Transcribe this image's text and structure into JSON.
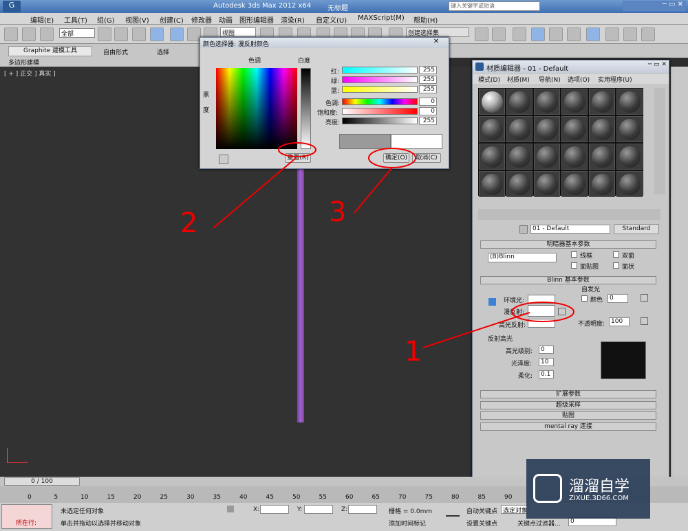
{
  "app": {
    "title": "Autodesk 3ds Max  2012 x64",
    "doc": "无标题",
    "search_placeholder": "键入关键字或短语"
  },
  "menu": [
    "编辑(E)",
    "工具(T)",
    "组(G)",
    "视图(V)",
    "创建(C)",
    "修改器",
    "动画",
    "图形编辑器",
    "渲染(R)",
    "自定义(U)",
    "MAXScript(M)",
    "帮助(H)"
  ],
  "toolbar": {
    "selection_filter": "全部",
    "ref_coord": "视图",
    "named_sel": "创建选择集"
  },
  "ribbon": {
    "tab1": "Graphite 建模工具",
    "tab2": "自由形式",
    "tab3": "选择",
    "panel": "多边形建模"
  },
  "viewport": {
    "label": "[ + ] 正交 ] 真实 ]"
  },
  "color_dialog": {
    "title": "颜色选择器: 漫反射颜色",
    "hue_label": "色调",
    "white_label": "白度",
    "black_label": "黑",
    "degree_label": "度",
    "red": "红:",
    "green": "绿:",
    "blue": "蓝:",
    "hue": "色调:",
    "sat": "饱和度:",
    "val": "亮度:",
    "red_val": "255",
    "green_val": "255",
    "blue_val": "255",
    "hue_val": "0",
    "sat_val": "0",
    "val_val": "255",
    "reset": "重置(R)",
    "ok": "确定(O)",
    "cancel": "取消(C)"
  },
  "mat_editor": {
    "title": "材质编辑器 - 01 - Default",
    "menu": [
      "模式(D)",
      "材质(M)",
      "导航(N)",
      "选项(O)",
      "实用程序(U)"
    ],
    "mat_name": "01 - Default",
    "mat_type": "Standard",
    "shader_rollout": "明暗器基本参数",
    "shader": "(B)Blinn",
    "wire": "线框",
    "two_sided": "双面",
    "face_map": "面贴图",
    "faceted": "面状",
    "blinn_rollout": "Blinn 基本参数",
    "self_illum": "自发光",
    "color": "颜色",
    "self_val": "0",
    "ambient": "环境光:",
    "diffuse": "漫反射:",
    "specular": "高光反射:",
    "opacity": "不透明度:",
    "opacity_val": "100",
    "spec_hl": "反射高光",
    "spec_level": "高光级别:",
    "spec_level_val": "0",
    "gloss": "光泽度:",
    "gloss_val": "10",
    "soften": "柔化:",
    "soften_val": "0.1",
    "extended": "扩展参数",
    "supersample": "超级采样",
    "maps": "贴图",
    "mental_ray": "mental ray 连接"
  },
  "timeline": {
    "frame": "0 / 100",
    "ticks": [
      "0",
      "5",
      "10",
      "15",
      "20",
      "25",
      "30",
      "35",
      "40",
      "45",
      "50",
      "55",
      "60",
      "65",
      "70",
      "75",
      "80",
      "85",
      "90"
    ]
  },
  "status": {
    "loc": "所在行:",
    "msg1": "未选定任何对象",
    "msg2": "单击并拖动以选择并移动对象",
    "x": "X:",
    "y": "Y:",
    "z": "Z:",
    "grid": "栅格 = 0.0mm",
    "addkey": "添加时间标记",
    "autokey": "自动关键点",
    "setkey": "设置关键点",
    "selobj": "选定对象",
    "keyfilter": "关键点过滤器...",
    "frame": "0"
  },
  "annotations": [
    "1",
    "2",
    "3"
  ],
  "watermark": {
    "brand": "溜溜自学",
    "url": "ZIXUE.3D66.COM"
  }
}
